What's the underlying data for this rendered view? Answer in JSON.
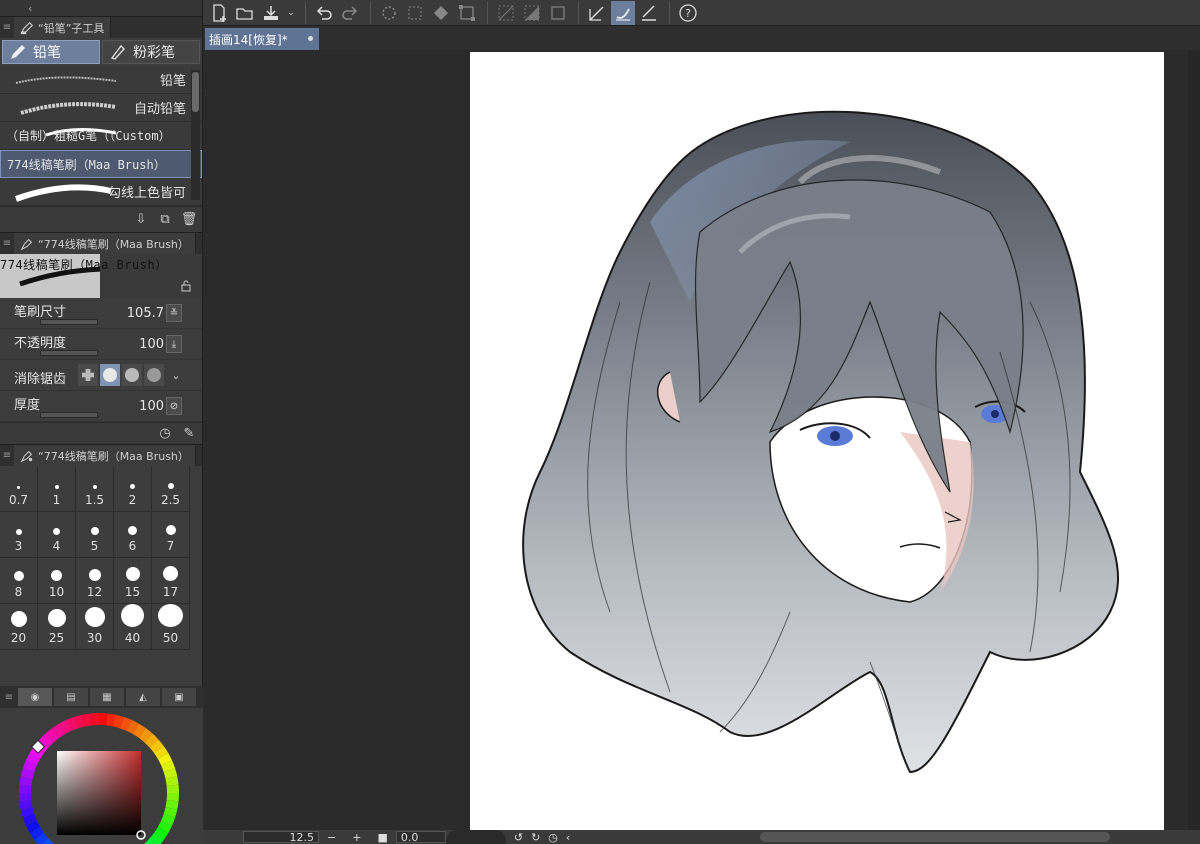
{
  "sub_tool_panel": {
    "title": "“铅笔”子工具",
    "groups": [
      {
        "label": "铅笔",
        "active": true
      },
      {
        "label": "粉彩笔",
        "active": false
      }
    ],
    "brushes": [
      {
        "label": "铅笔"
      },
      {
        "label": "自动铅笔"
      },
      {
        "label": "（自制）粗糙G笔（（Custom）"
      },
      {
        "label": "774线稿笔刷（Maa Brush）",
        "selected": true
      },
      {
        "label": "勾线上色皆可"
      }
    ]
  },
  "tool_property_panel": {
    "title": "“774线稿笔刷（Maa Brush）",
    "preview_name": "774线稿笔刷（Maa Brush）",
    "brush_size": {
      "label": "笔刷尺寸",
      "value": "105.7"
    },
    "opacity": {
      "label": "不透明度",
      "value": "100"
    },
    "antialiasing": {
      "label": "消除锯齿",
      "level": 1
    },
    "thickness": {
      "label": "厚度",
      "value": "100"
    }
  },
  "brush_size_panel": {
    "title": "“774线稿笔刷（Maa Brush）",
    "sizes": [
      "0.7",
      "1",
      "1.5",
      "2",
      "2.5",
      "3",
      "4",
      "5",
      "6",
      "7",
      "8",
      "10",
      "12",
      "15",
      "17",
      "20",
      "25",
      "30",
      "40",
      "50"
    ]
  },
  "document": {
    "tab_title": "插画14[恢复]*"
  },
  "status_bar": {
    "zoom": "12.5",
    "rotation": "0.0"
  },
  "colors": {
    "accent": "#6d7f9c",
    "panel_bg": "#3c3c3c",
    "workspace_bg": "#2b2b2b",
    "color_square_base": "#c42d2d"
  }
}
